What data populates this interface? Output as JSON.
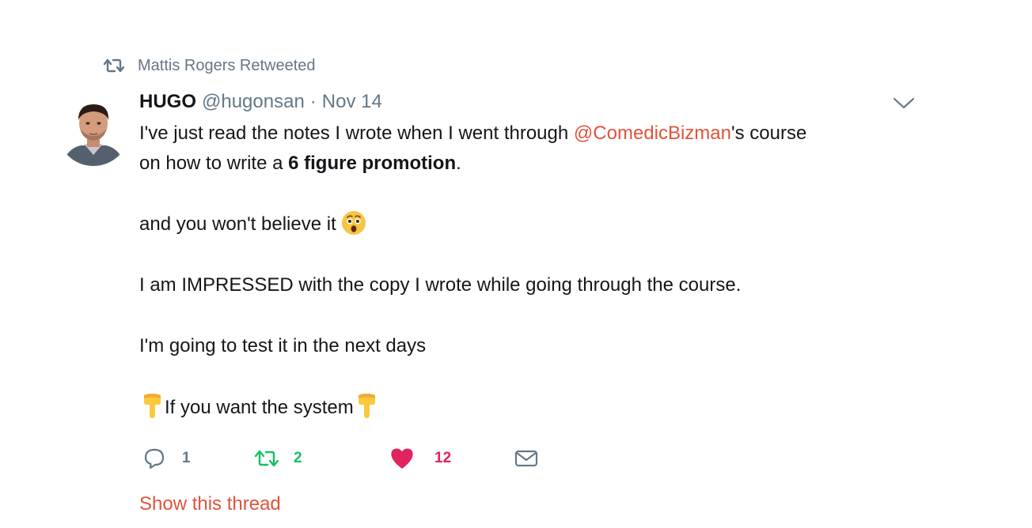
{
  "retweet_context": {
    "icon": "retweet-icon",
    "text": "Mattis Rogers Retweeted"
  },
  "tweet": {
    "avatar": "avatar-photo",
    "fullname": "HUGO",
    "handle": "@hugonsan",
    "separator": "·",
    "date": "Nov 14",
    "caret_icon": "chevron-down-icon",
    "text": {
      "line1_before": "I've just read the notes I wrote when I went through ",
      "line1_mention": "@ComedicBizman",
      "line1_after": "'s course",
      "line2_before": "on how to write a ",
      "line2_bold": "6 figure promotion",
      "line2_after": ".",
      "line3": "and you won't believe it ",
      "line3_emoji": "astonished-face-emoji",
      "line4": "I am IMPRESSED with the copy I wrote while going through the course.",
      "line5": "I'm going to test it in the next days",
      "line6_emoji_left": "pointing-down-emoji",
      "line6": "If you want the system",
      "line6_emoji_right": "pointing-down-emoji"
    },
    "actions": {
      "reply": {
        "icon": "reply-icon",
        "count": "1"
      },
      "retweet": {
        "icon": "retweet-icon",
        "count": "2",
        "color": "#17bf63"
      },
      "like": {
        "icon": "heart-icon",
        "count": "12",
        "color": "#e0245e"
      },
      "dm": {
        "icon": "envelope-icon"
      }
    },
    "show_thread": "Show this thread"
  },
  "colors": {
    "text": "#14171a",
    "secondary": "#657786",
    "link": "#e0533d"
  }
}
